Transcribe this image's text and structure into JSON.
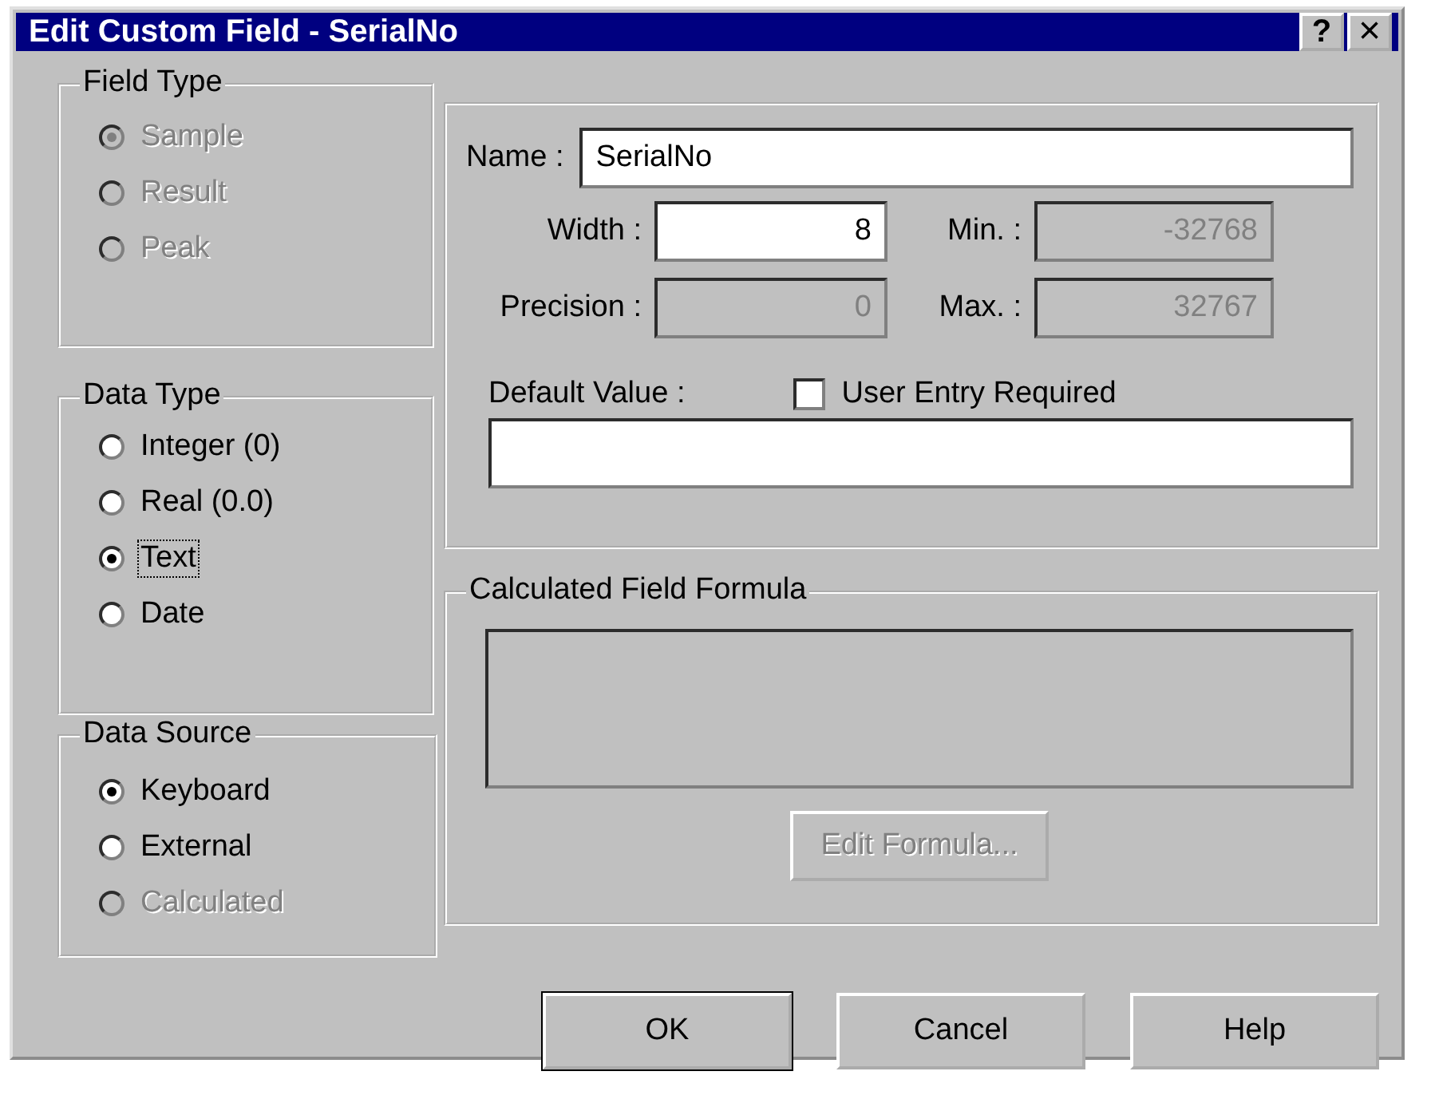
{
  "window": {
    "title": "Edit Custom Field - SerialNo",
    "title_buttons": [
      {
        "label": "?",
        "kind": "help"
      },
      {
        "label": "×",
        "kind": "close"
      }
    ]
  },
  "field_type": {
    "title": "Field Type",
    "options": [
      {
        "label": "Sample",
        "selected": true,
        "disabled": true,
        "focused": false
      },
      {
        "label": "Result",
        "selected": false,
        "disabled": true,
        "focused": false
      },
      {
        "label": "Peak",
        "selected": false,
        "disabled": true,
        "focused": false
      }
    ]
  },
  "data_type": {
    "title": "Data Type",
    "options": [
      {
        "label": "Integer (0)",
        "selected": false,
        "disabled": false,
        "focused": false
      },
      {
        "label": "Real (0.0)",
        "selected": false,
        "disabled": false,
        "focused": false
      },
      {
        "label": "Text",
        "selected": true,
        "disabled": false,
        "focused": true
      },
      {
        "label": "Date",
        "selected": false,
        "disabled": false,
        "focused": false
      }
    ]
  },
  "data_source": {
    "title": "Data Source",
    "options": [
      {
        "label": "Keyboard",
        "selected": true,
        "disabled": false,
        "focused": false
      },
      {
        "label": "External",
        "selected": false,
        "disabled": false,
        "focused": false
      },
      {
        "label": "Calculated",
        "selected": false,
        "disabled": true,
        "focused": false
      }
    ]
  },
  "properties": {
    "name": {
      "label": "Name :",
      "value": "SerialNo"
    },
    "width": {
      "label": "Width :",
      "value": "8",
      "disabled": false
    },
    "min": {
      "label": "Min. :",
      "value": "-32768",
      "disabled": true
    },
    "precision": {
      "label": "Precision :",
      "value": "0",
      "disabled": true
    },
    "max": {
      "label": "Max. :",
      "value": "32767",
      "disabled": true
    },
    "default_value": {
      "label": "Default Value :"
    },
    "user_entry_required": {
      "label": "User Entry Required",
      "checked": false
    }
  },
  "formula": {
    "title": "Calculated Field Formula",
    "button": {
      "label": "Edit Formula...",
      "disabled": true
    }
  },
  "buttons": [
    {
      "label": "OK",
      "default": true
    },
    {
      "label": "Cancel",
      "default": false
    },
    {
      "label": "Help",
      "default": false
    }
  ]
}
